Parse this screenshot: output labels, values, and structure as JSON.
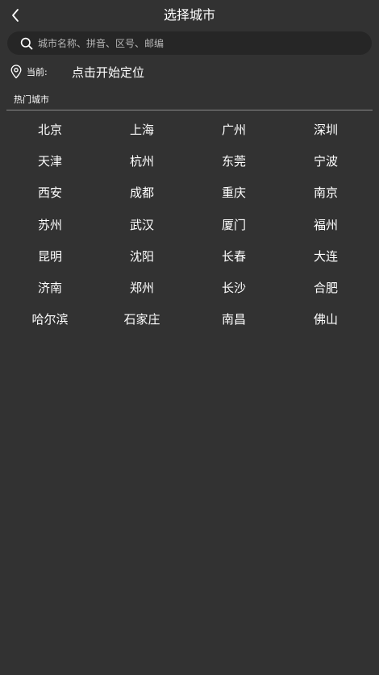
{
  "header": {
    "title": "选择城市",
    "back_icon": "chevron-left-icon"
  },
  "search": {
    "placeholder": "城市名称、拼音、区号、邮编",
    "value": "",
    "icon": "search-icon"
  },
  "location": {
    "icon": "map-pin-icon",
    "current_label": "当前:",
    "locate_label": "点击开始定位"
  },
  "hot_cities": {
    "label": "热门城市",
    "cities": [
      "北京",
      "上海",
      "广州",
      "深圳",
      "天津",
      "杭州",
      "东莞",
      "宁波",
      "西安",
      "成都",
      "重庆",
      "南京",
      "苏州",
      "武汉",
      "厦门",
      "福州",
      "昆明",
      "沈阳",
      "长春",
      "大连",
      "济南",
      "郑州",
      "长沙",
      "合肥",
      "哈尔滨",
      "石家庄",
      "南昌",
      "佛山"
    ]
  },
  "colors": {
    "background": "#323232",
    "search_background": "#262626",
    "text": "#ffffff",
    "divider": "#8a8a8a"
  }
}
